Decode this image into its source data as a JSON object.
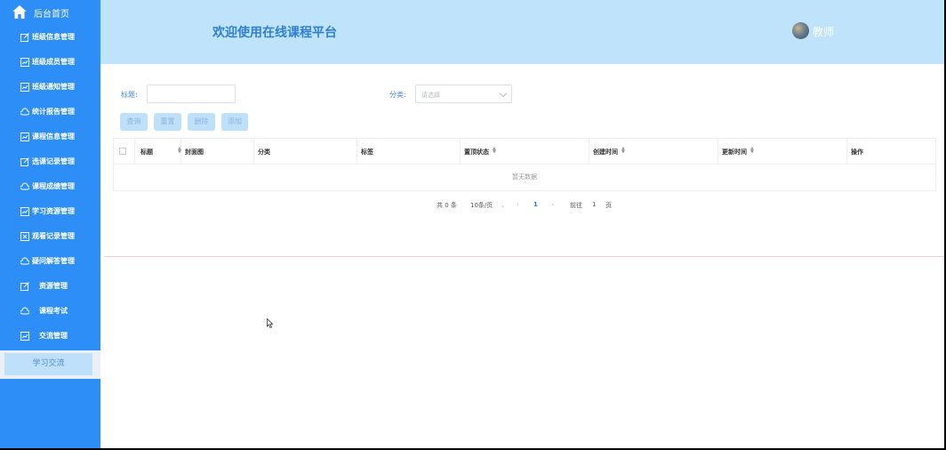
{
  "sidebar": {
    "home": "后台首页",
    "items": [
      {
        "label": "班级信息管理",
        "icon": "edit-icon"
      },
      {
        "label": "班级成员管理",
        "icon": "chart-icon"
      },
      {
        "label": "班级通知管理",
        "icon": "chart-icon"
      },
      {
        "label": "统计报告管理",
        "icon": "cloud-icon"
      },
      {
        "label": "课程信息管理",
        "icon": "chart-icon"
      },
      {
        "label": "选课记录管理",
        "icon": "edit-icon"
      },
      {
        "label": "课程成绩管理",
        "icon": "cloud-icon"
      },
      {
        "label": "学习资源管理",
        "icon": "chart-icon"
      },
      {
        "label": "观看记录管理",
        "icon": "document-icon"
      },
      {
        "label": "疑问解答管理",
        "icon": "cloud-icon"
      },
      {
        "label": "资源管理",
        "icon": "edit-icon"
      },
      {
        "label": "课程考试",
        "icon": "cloud-icon"
      },
      {
        "label": "交流管理",
        "icon": "chart-icon"
      }
    ],
    "active": "学习交流"
  },
  "header": {
    "title": "欢迎使用在线课程平台",
    "role": "教师"
  },
  "search": {
    "title_label": "标题:",
    "category_label": "分类:",
    "category_placeholder": "请选择"
  },
  "buttons": {
    "query": "查询",
    "reset": "重置",
    "delete": "删除",
    "add": "添加"
  },
  "table": {
    "columns": [
      "标题",
      "封面图",
      "分类",
      "标签",
      "置顶状态",
      "创建时间",
      "更新时间",
      "操作"
    ],
    "empty_text": "暂无数据"
  },
  "pagination": {
    "total": "共 0 条",
    "page_size": "10条/页",
    "current_page": "1",
    "goto_label": "前往",
    "goto_value": "1",
    "page_unit": "页"
  },
  "colors": {
    "sidebar": "#2e8ef7",
    "header": "#bfe3fb",
    "accent": "#2f7fd3"
  }
}
